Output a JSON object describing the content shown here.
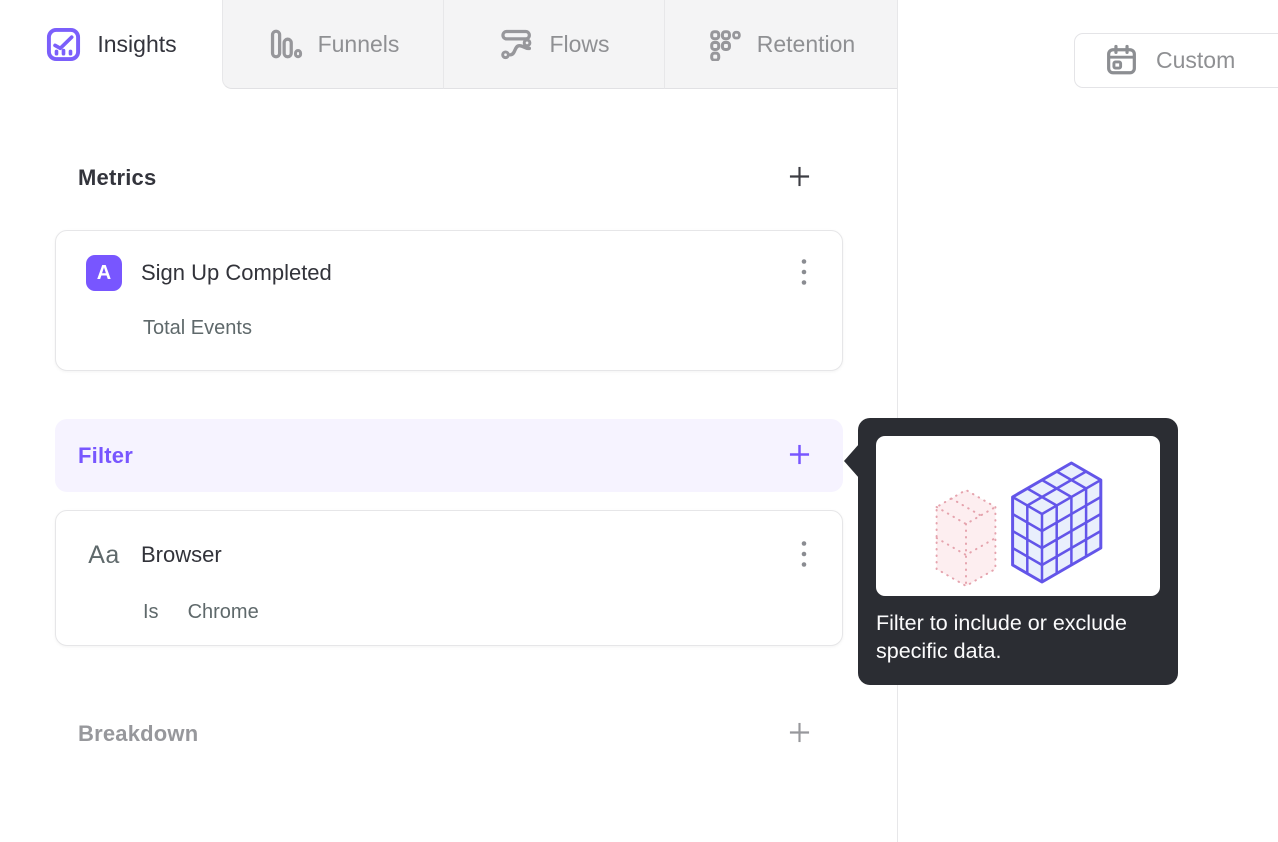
{
  "tabs": [
    {
      "label": "Insights",
      "icon": "line-chart-icon",
      "active": true
    },
    {
      "label": "Funnels",
      "icon": "bar-funnel-icon",
      "active": false
    },
    {
      "label": "Flows",
      "icon": "wave-flow-icon",
      "active": false
    },
    {
      "label": "Retention",
      "icon": "dot-grid-icon",
      "active": false
    }
  ],
  "date_picker": {
    "label": "Custom",
    "icon": "calendar-icon"
  },
  "builder": {
    "metrics_section": {
      "title": "Metrics",
      "add_icon": "plus-icon"
    },
    "metric_card": {
      "badge": "A",
      "event_name": "Sign Up Completed",
      "aggregation": "Total Events",
      "menu_icon": "kebab-menu-icon"
    },
    "filter_section": {
      "title": "Filter",
      "add_icon": "plus-icon"
    },
    "filter_card": {
      "type_icon_label": "Aa",
      "property": "Browser",
      "operator": "Is",
      "value": "Chrome",
      "menu_icon": "kebab-menu-icon"
    },
    "breakdown_section": {
      "title": "Breakdown",
      "add_icon": "plus-icon"
    }
  },
  "tooltip": {
    "text": "Filter to include or exclude specific data.",
    "illustration": "isometric-cube-grid"
  },
  "colors": {
    "accent_purple": "#7856ff",
    "filter_row_bg": "#f6f3ff",
    "tooltip_bg": "#2b2d33",
    "tab_inactive_bg": "#f4f4f5",
    "border_gray": "#e6e6e8",
    "text_dark": "#32333a",
    "text_gray": "#8f9093",
    "text_muted": "#5f696b",
    "cube_purple": "#6355e9",
    "cube_fill": "#e9effc",
    "cube_pink": "#e5a3ad",
    "cube_pink_fill": "#fdeef0"
  }
}
